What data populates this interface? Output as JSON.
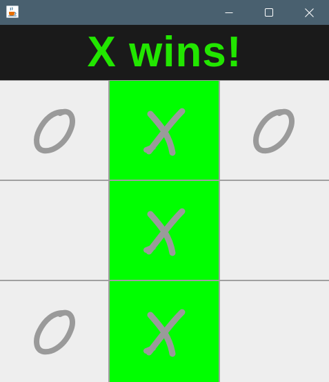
{
  "window": {
    "title": "",
    "titlebar_color": "#49606f",
    "icons": {
      "app": "java-cup-icon",
      "minimize": "minimize-icon",
      "maximize": "maximize-icon",
      "close": "close-icon"
    }
  },
  "status": {
    "text": "X wins!",
    "color": "#22e600",
    "background": "#1a1a1a"
  },
  "board": {
    "rows": [
      [
        "O",
        "X",
        "O"
      ],
      [
        "",
        "X",
        ""
      ],
      [
        "O",
        "X",
        ""
      ]
    ],
    "winning_cells": [
      [
        0,
        1
      ],
      [
        1,
        1
      ],
      [
        2,
        1
      ]
    ],
    "win_color": "#00ff00",
    "mark_color": "#9a9a9a",
    "cell_color": "#eeeeee"
  }
}
